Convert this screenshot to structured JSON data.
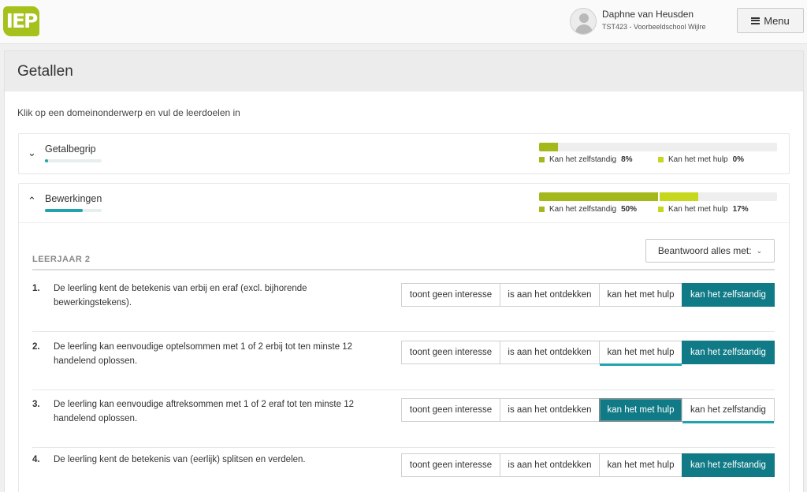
{
  "header": {
    "logo_text": "IEP",
    "brand_color": "#a5c11b",
    "user": {
      "name": "Daphne van Heusden",
      "school": "TST423 - Voorbeeldschool Wijlre"
    },
    "menu_label": "Menu"
  },
  "page": {
    "title": "Getallen",
    "instruction": "Klik op een domeinonderwerp en vul de leerdoelen in"
  },
  "domains": [
    {
      "title": "Getalbegrip",
      "expanded": false,
      "chevron": "chevron-down-icon",
      "mini_progress": 0.06,
      "zelfstandig_label": "Kan het zelfstandig",
      "zelfstandig_value": "8%",
      "zelfstandig_pct": 8,
      "hulp_label": "Kan het met hulp",
      "hulp_value": "0%",
      "hulp_pct": 0
    },
    {
      "title": "Bewerkingen",
      "expanded": true,
      "chevron": "chevron-up-icon",
      "mini_progress": 0.67,
      "zelfstandig_label": "Kan het zelfstandig",
      "zelfstandig_value": "50%",
      "zelfstandig_pct": 50,
      "hulp_label": "Kan het met hulp",
      "hulp_value": "17%",
      "hulp_pct": 17
    }
  ],
  "section": {
    "leerjaar": "LEERJAAR 2",
    "beantwoord_label": "Beantwoord alles met:"
  },
  "options": [
    "toont geen interesse",
    "is aan het ontdekken",
    "kan het met hulp",
    "kan het zelfstandig"
  ],
  "goals": [
    {
      "num": "1.",
      "text": "De leerling kent de betekenis van erbij en eraf (excl. bijhorende bewerkingstekens).",
      "selected": "kan het zelfstandig"
    },
    {
      "num": "2.",
      "text": "De leerling kan eenvoudige optelsommen met 1 of 2 erbij tot ten minste 12 handelend oplossen.",
      "selected": "kan het zelfstandig",
      "previous": "kan het met hulp"
    },
    {
      "num": "3.",
      "text": "De leerling kan eenvoudige aftreksommen met 1 of 2 eraf tot ten minste 12 handelend oplossen.",
      "selected": "kan het met hulp",
      "previous": "kan het zelfstandig"
    },
    {
      "num": "4.",
      "text": "De leerling kent de betekenis van (eerlijk) splitsen en verdelen.",
      "selected": "kan het zelfstandig"
    }
  ],
  "colors": {
    "selected": "#107a86",
    "zelfstandig": "#a5b81b",
    "hulp": "#c6d81e",
    "underline": "#1fa3ae"
  }
}
